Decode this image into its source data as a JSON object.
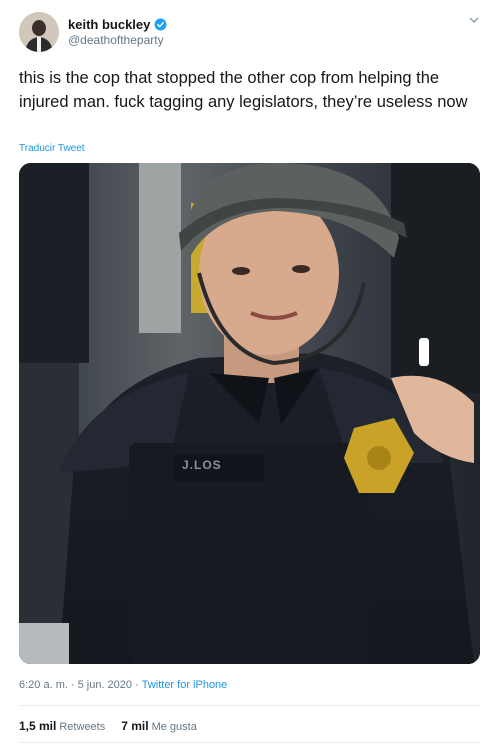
{
  "author": {
    "name": "keith buckley",
    "handle": "@deathoftheparty"
  },
  "tweet": {
    "text": "this is the cop that stopped the other cop from helping the injured man. fuck tagging any legislators, they’re useless now",
    "translate_label": "Traducir Tweet"
  },
  "meta": {
    "time": "6:20 a. m.",
    "separator": "·",
    "date": "5 jun. 2020",
    "source": "Twitter for iPhone"
  },
  "stats": {
    "retweets_count": "1,5 mil",
    "retweets_label": "Retweets",
    "likes_count": "7 mil",
    "likes_label": "Me gusta"
  },
  "media": {
    "vest_text": "J.LOS"
  },
  "colors": {
    "accent": "#1b95e0",
    "text": "#14171a",
    "secondary": "#657786"
  },
  "icons": {
    "verified": "verified-badge-icon",
    "caret": "chevron-down-icon"
  }
}
